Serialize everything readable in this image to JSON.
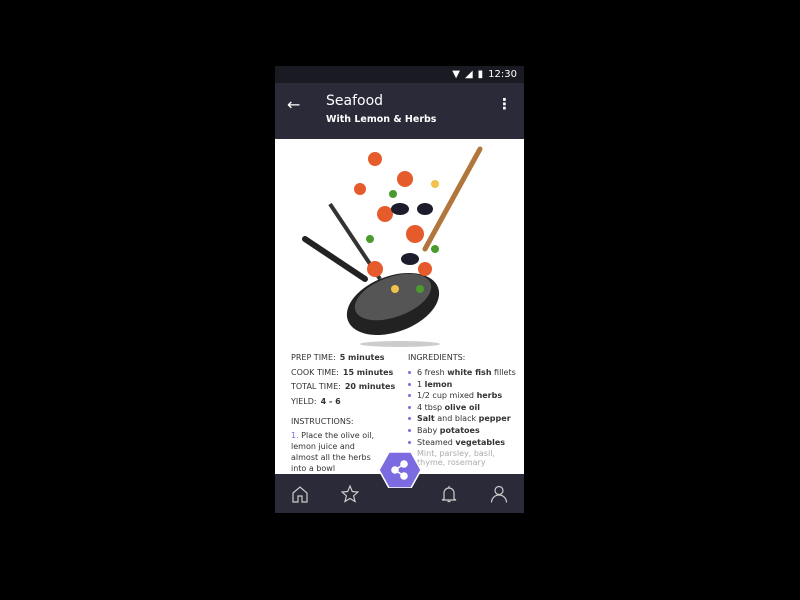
{
  "status": {
    "time": "12:30"
  },
  "appbar": {
    "title": "Seafood",
    "subtitle": "With Lemon & Herbs"
  },
  "details": [
    {
      "label": "PREP TIME:",
      "value": "5 minutes"
    },
    {
      "label": "COOK TIME:",
      "value": "15 minutes"
    },
    {
      "label": "TOTAL TIME:",
      "value": "20 minutes"
    },
    {
      "label": "YIELD:",
      "value": "4 - 6"
    }
  ],
  "instructions": {
    "heading": "INSTRUCTIONS:",
    "num": "1.",
    "step": " Place the olive oil, lemon juice and almost all the herbs into a bowl"
  },
  "ingredients": {
    "heading": "INGREDIENTS:",
    "items": [
      [
        {
          "t": "6 fresh "
        },
        {
          "b": "white fish"
        },
        {
          "t": " fillets"
        }
      ],
      [
        {
          "t": "1  "
        },
        {
          "b": "lemon"
        }
      ],
      [
        {
          "t": "1/2 cup mixed "
        },
        {
          "b": "herbs"
        }
      ],
      [
        {
          "t": "4 tbsp "
        },
        {
          "b": "olive oil"
        }
      ],
      [
        {
          "b": "Salt"
        },
        {
          "t": " and black "
        },
        {
          "b": "pepper"
        }
      ],
      [
        {
          "t": "Baby "
        },
        {
          "b": "potatoes"
        }
      ],
      [
        {
          "t": "Steamed "
        },
        {
          "b": "vegetables"
        }
      ],
      [
        {
          "t": "Mint, parsley, basil, thyme, rosemary"
        }
      ]
    ]
  },
  "accent": "#7b6be0",
  "nav": [
    "home-icon",
    "star-icon",
    "share-icon",
    "bell-icon",
    "user-icon"
  ]
}
